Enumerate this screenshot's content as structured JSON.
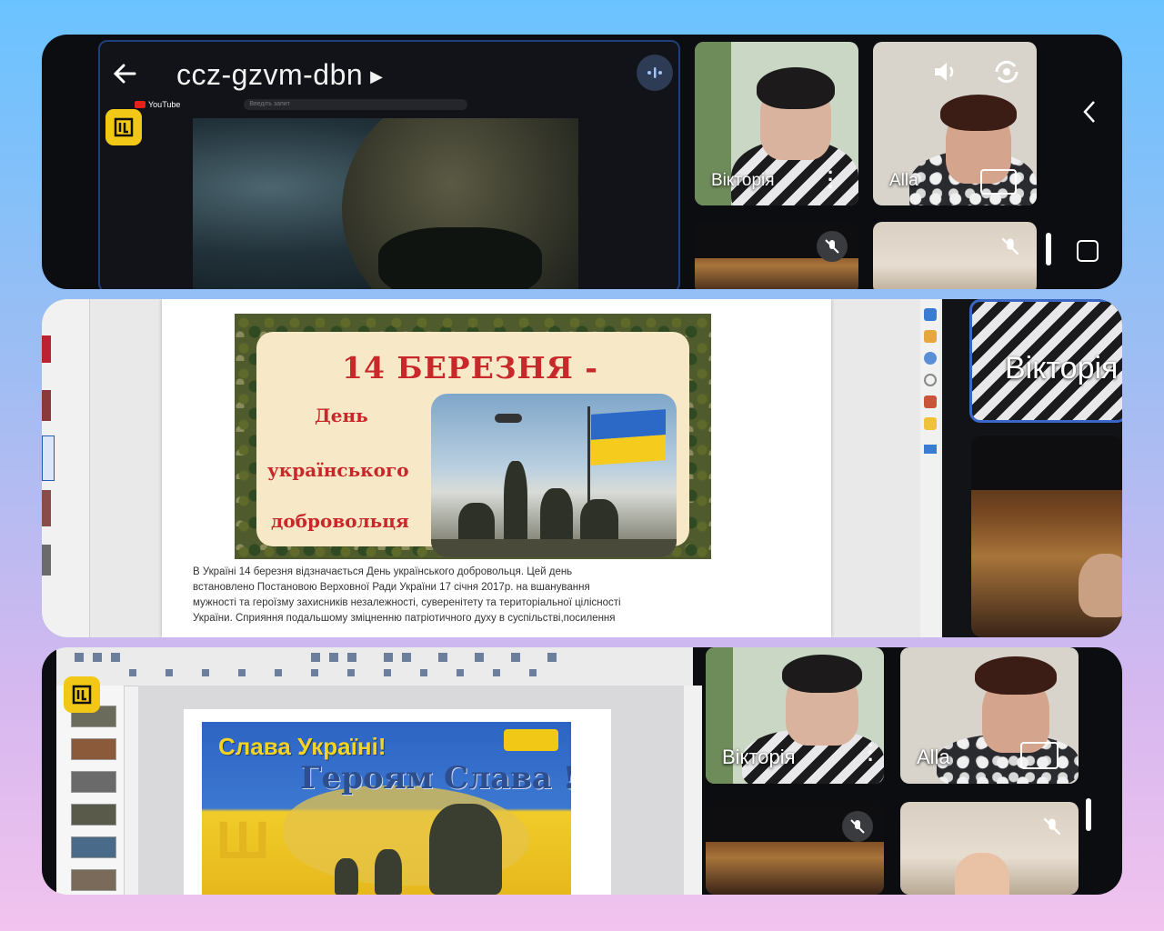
{
  "panel_top": {
    "meeting_code": "ccz-gzvm-dbn",
    "youtube_brand": "YouTube",
    "youtube_search_placeholder": "Введіть запит",
    "participants": [
      {
        "name": "Вікторія"
      },
      {
        "name": "Alla"
      }
    ]
  },
  "panel_middle": {
    "poster_title": "14 БЕРЕЗНЯ -",
    "poster_line1": "День",
    "poster_line2": "українського",
    "poster_line3": "добровольця",
    "doc_paragraph": [
      "В Україні 14 березня відзначається День українського добровольця. Цей день",
      "встановлено Постановою Верховної Ради України 17 січня  2017р. на вшанування",
      "мужності та героїзму захисників незалежності, суверенітету та територіальної цілісності",
      "України. Сприяння подальшому зміцненню патріотичного духу в суспільстві,посилення"
    ],
    "participant_name": "Вікторія"
  },
  "panel_bottom": {
    "slide_line1": "Слава Україні!",
    "slide_line2": "Героям Слава !",
    "participants": [
      {
        "name": "Вікторія"
      },
      {
        "name": "Alla"
      }
    ]
  },
  "colors": {
    "accent_blue": "#2c68c6",
    "accent_yellow": "#f5cc1d",
    "poster_red": "#c8282a",
    "app_badge": "#f2c816"
  }
}
